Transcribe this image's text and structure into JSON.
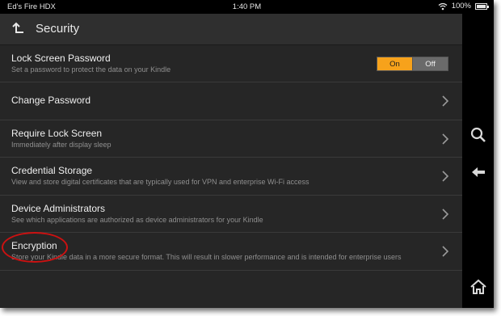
{
  "status_bar": {
    "device_name": "Ed's Fire HDX",
    "time": "1:40 PM",
    "battery_text": "100%",
    "battery_level": 1.0,
    "icons": [
      "wifi-icon",
      "battery-icon"
    ]
  },
  "header": {
    "title": "Security",
    "back_icon": "back-arrow-icon"
  },
  "settings": {
    "lock_screen_password": {
      "label": "Lock Screen Password",
      "description": "Set a password to protect the data on your Kindle",
      "toggle": {
        "on_label": "On",
        "off_label": "Off",
        "selected": "On"
      }
    },
    "change_password": {
      "label": "Change Password"
    },
    "require_lock_screen": {
      "label": "Require Lock Screen",
      "description": "Immediately after display sleep"
    },
    "credential_storage": {
      "label": "Credential Storage",
      "description": "View and store digital certificates that are typically used for VPN and enterprise Wi-Fi access"
    },
    "device_administrators": {
      "label": "Device Administrators",
      "description": "See which applications are authorized as device administrators for your Kindle"
    },
    "encryption": {
      "label": "Encryption",
      "description": "Store your Kindle data in a more secure format. This will result in slower performance and is intended for enterprise users"
    }
  },
  "nav_panel": {
    "icons": [
      "search-icon",
      "back-icon",
      "home-icon"
    ]
  },
  "colors": {
    "accent": "#f7a21b",
    "background": "#262626",
    "highlight_circle": "#cc1111"
  }
}
